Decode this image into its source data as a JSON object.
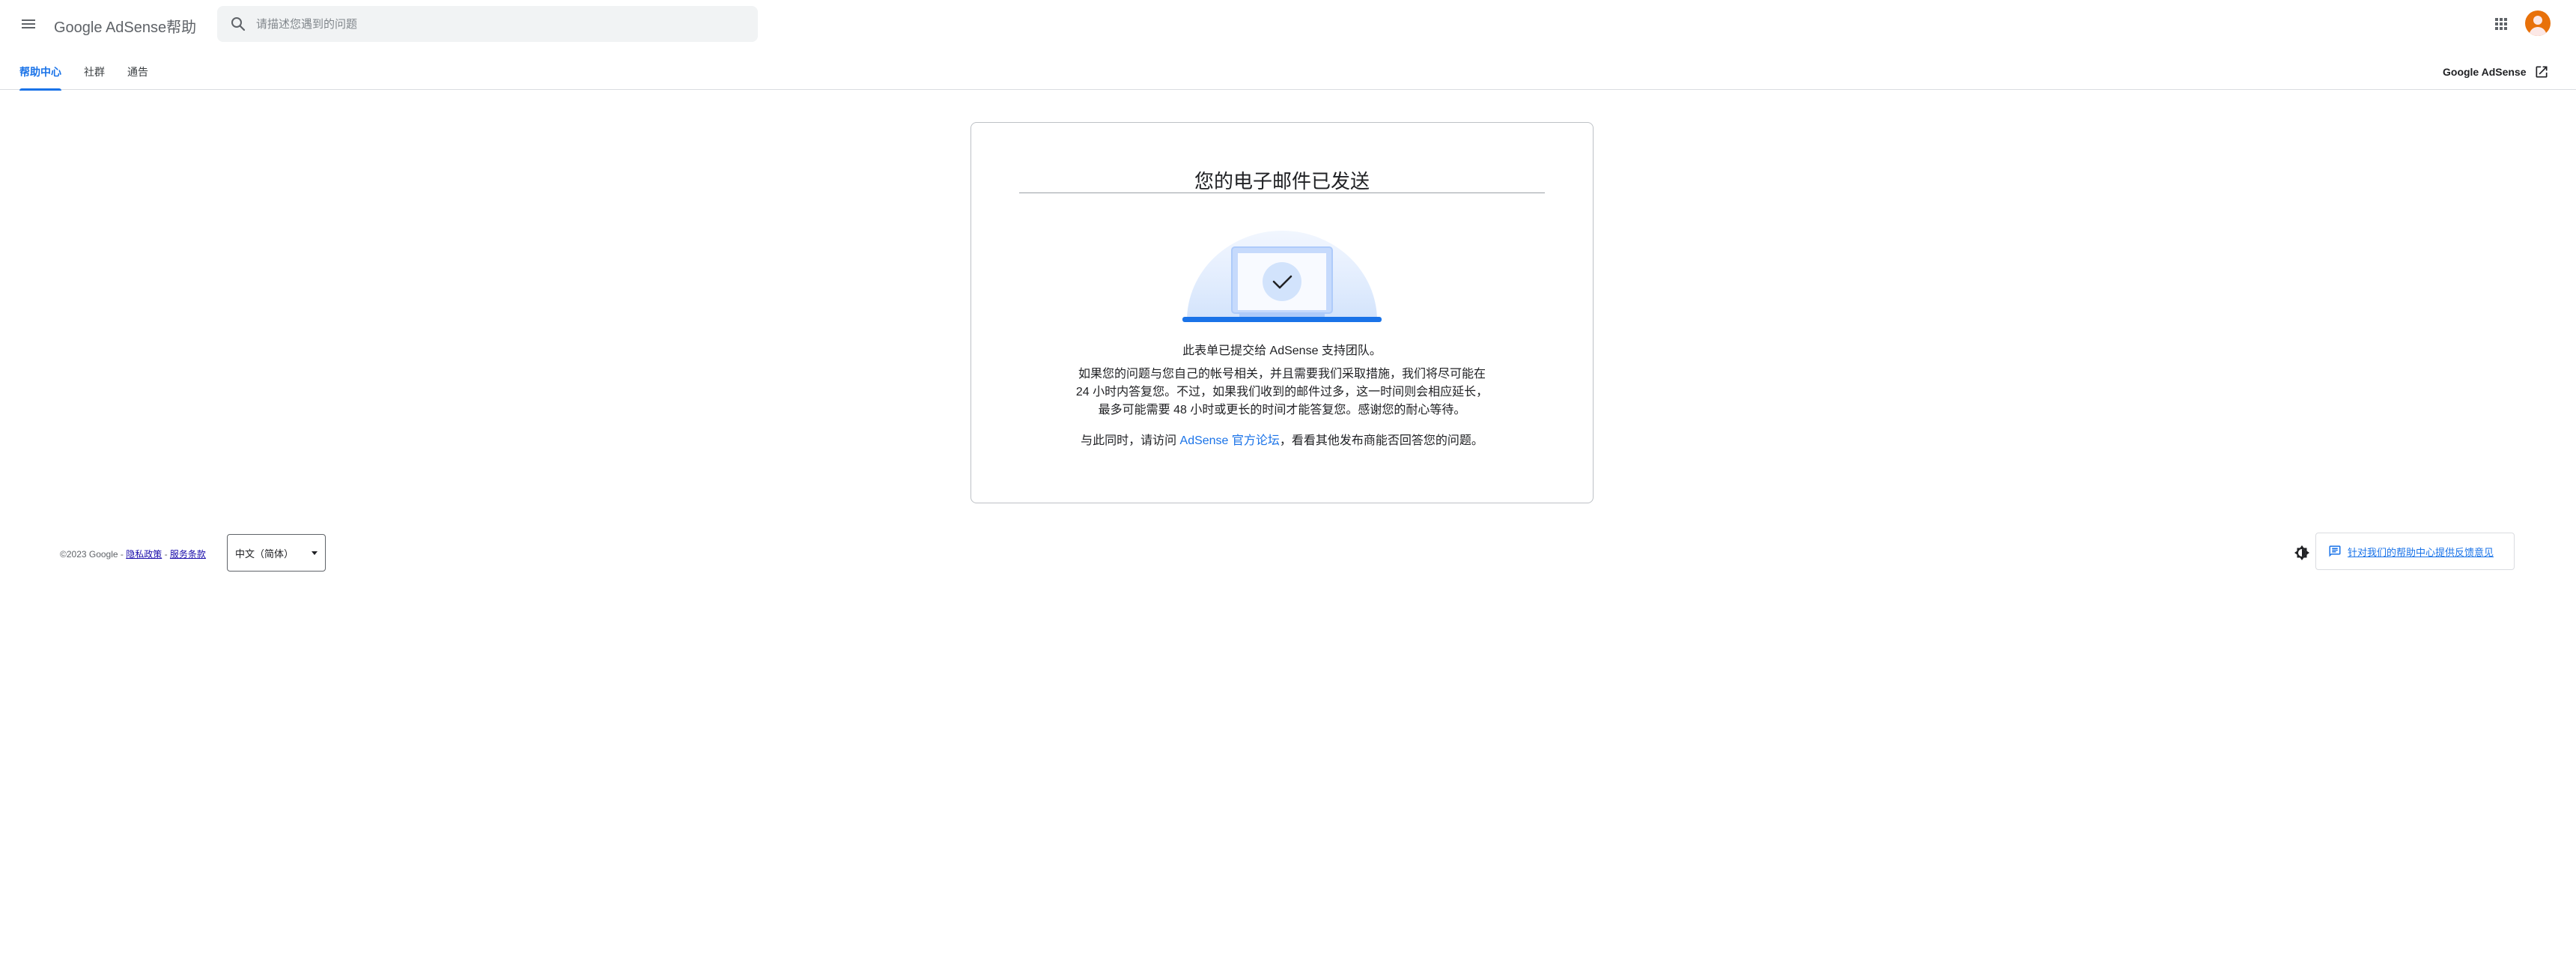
{
  "header": {
    "brand": "Google AdSense帮助",
    "search_placeholder": "请描述您遇到的问题"
  },
  "tabs": [
    {
      "label": "帮助中心",
      "active": true
    },
    {
      "label": "社群",
      "active": false
    },
    {
      "label": "通告",
      "active": false
    }
  ],
  "external_link": {
    "label": "Google AdSense"
  },
  "card": {
    "title": "您的电子邮件已发送",
    "line1": "此表单已提交给 AdSense 支持团队。",
    "line2": "如果您的问题与您自己的帐号相关，并且需要我们采取措施，我们将尽可能在 24 小时内答复您。不过，如果我们收到的邮件过多，这一时间则会相应延长，最多可能需要 48 小时或更长的时间才能答复您。感谢您的耐心等待。",
    "line3_prefix": "与此同时，请访问 ",
    "line3_link": "AdSense 官方论坛",
    "line3_suffix": "，看看其他发布商能否回答您的问题。"
  },
  "footer": {
    "copyright": "©2023 Google - ",
    "privacy": "隐私政策",
    "separator": " - ",
    "terms": "服务条款",
    "language": "中文（简体）",
    "feedback": "针对我们的帮助中心提供反馈意见"
  },
  "colors": {
    "accent": "#1a73e8",
    "avatar": "#e8710a"
  },
  "icons": {
    "menu": "menu-icon",
    "search": "search-icon",
    "apps": "apps-grid-icon",
    "avatar": "avatar",
    "external": "open-in-new-icon",
    "check": "check-icon",
    "theme": "brightness-icon",
    "feedback": "feedback-icon"
  }
}
